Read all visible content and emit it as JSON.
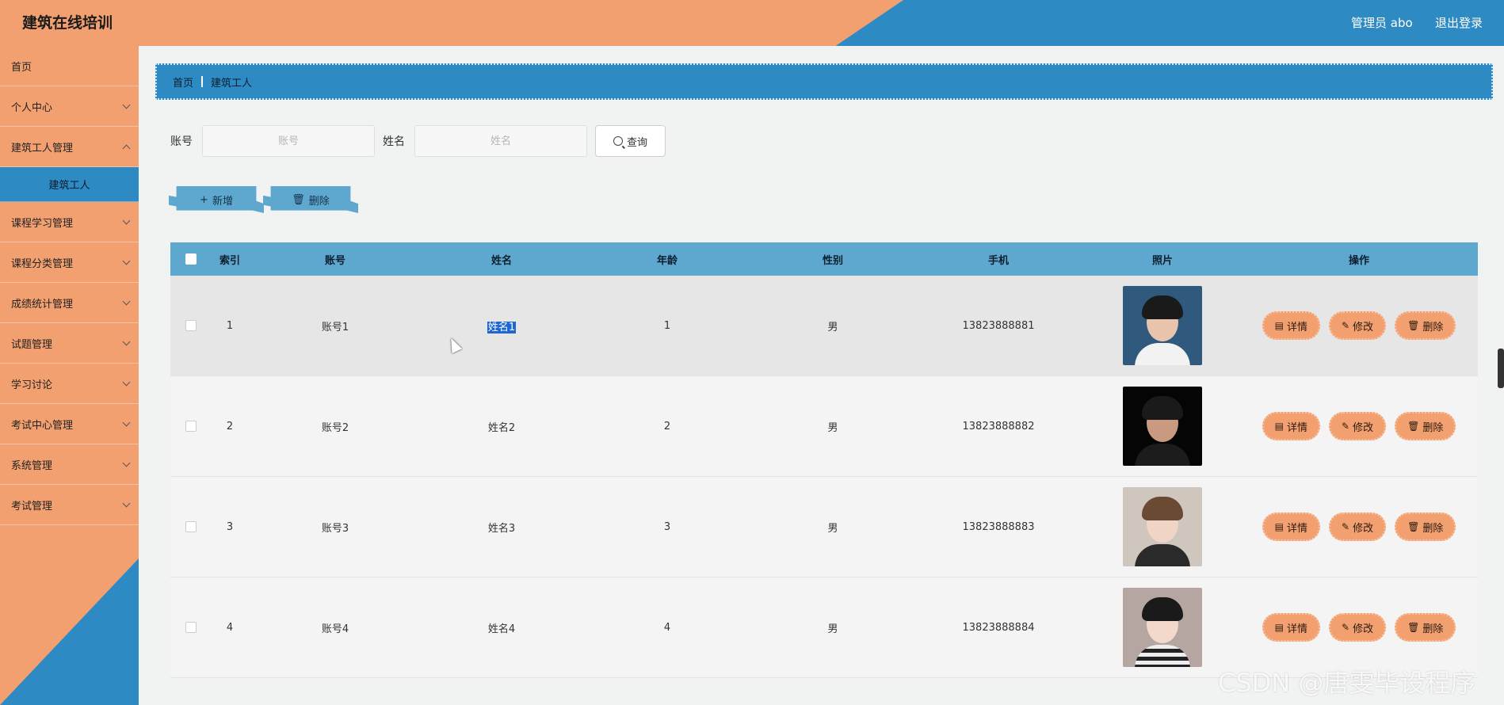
{
  "header": {
    "title": "建筑在线培训",
    "user_label": "管理员 abo",
    "logout_label": "退出登录"
  },
  "sidebar": {
    "items": [
      {
        "label": "首页"
      },
      {
        "label": "个人中心"
      },
      {
        "label": "建筑工人管理"
      },
      {
        "label": "建筑工人"
      },
      {
        "label": "课程学习管理"
      },
      {
        "label": "课程分类管理"
      },
      {
        "label": "成绩统计管理"
      },
      {
        "label": "试题管理"
      },
      {
        "label": "学习讨论"
      },
      {
        "label": "考试中心管理"
      },
      {
        "label": "系统管理"
      },
      {
        "label": "考试管理"
      }
    ]
  },
  "breadcrumb": {
    "home": "首页",
    "current": "建筑工人"
  },
  "search": {
    "account_label": "账号",
    "account_placeholder": "账号",
    "name_label": "姓名",
    "name_placeholder": "姓名",
    "query_label": "查询"
  },
  "actions": {
    "add_label": "新增",
    "delete_label": "删除"
  },
  "table": {
    "headers": [
      "索引",
      "账号",
      "姓名",
      "年龄",
      "性别",
      "手机",
      "照片",
      "操作"
    ],
    "ops": {
      "detail": "详情",
      "edit": "修改",
      "delete": "删除"
    },
    "rows": [
      {
        "index": "1",
        "account": "账号1",
        "name": "姓名1",
        "age": "1",
        "sex": "男",
        "phone": "13823888881"
      },
      {
        "index": "2",
        "account": "账号2",
        "name": "姓名2",
        "age": "2",
        "sex": "男",
        "phone": "13823888882"
      },
      {
        "index": "3",
        "account": "账号3",
        "name": "姓名3",
        "age": "3",
        "sex": "男",
        "phone": "13823888883"
      },
      {
        "index": "4",
        "account": "账号4",
        "name": "姓名4",
        "age": "4",
        "sex": "男",
        "phone": "13823888884"
      }
    ]
  },
  "watermark": "CSDN @唐雯毕设程序",
  "colors": {
    "orange": "#f3a070",
    "blue": "#2d8ac3",
    "header_blue": "#5ea7cf"
  },
  "icons": {
    "search": "search-icon",
    "add": "plus-icon",
    "delete": "trash-icon",
    "detail": "document-icon",
    "edit": "pencil-icon"
  }
}
